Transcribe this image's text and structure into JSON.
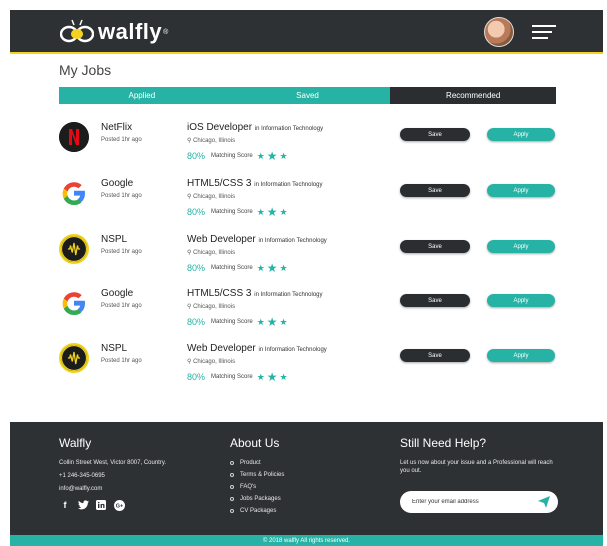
{
  "header": {
    "brand": "walfly",
    "brand_mark": "®",
    "colors": {
      "bar": "#2e3134",
      "accent": "#f4d21f"
    }
  },
  "page_title": "My Jobs",
  "tabs": [
    {
      "label": "Applied",
      "active": false
    },
    {
      "label": "Saved",
      "active": false
    },
    {
      "label": "Recommended",
      "active": true
    }
  ],
  "jobs": [
    {
      "company": "NetFlix",
      "logo": "netflix-logo",
      "posted": "Posted 1hr ago",
      "title": "iOS Developer",
      "category": "in Information Technology",
      "location": "Chicago, Illinois",
      "score": "80%",
      "score_label": "Matching Score",
      "save": "Save",
      "apply": "Apply"
    },
    {
      "company": "Google",
      "logo": "google-logo",
      "posted": "Posted 1hr ago",
      "title": "HTML5/CSS 3",
      "category": "in Information Technology",
      "location": "Chicago, Illinois",
      "score": "80%",
      "score_label": "Matching Score",
      "save": "Save",
      "apply": "Apply"
    },
    {
      "company": "NSPL",
      "logo": "nspl-logo",
      "posted": "Posted 1hr ago",
      "title": "Web Developer",
      "category": "in Information Technology",
      "location": "Chicago, Illinois",
      "score": "80%",
      "score_label": "Matching Score",
      "save": "Save",
      "apply": "Apply"
    },
    {
      "company": "Google",
      "logo": "google-logo",
      "posted": "Posted 1hr ago",
      "title": "HTML5/CSS 3",
      "category": "in Information Technology",
      "location": "Chicago, Illinois",
      "score": "80%",
      "score_label": "Matching Score",
      "save": "Save",
      "apply": "Apply"
    },
    {
      "company": "NSPL",
      "logo": "nspl-logo",
      "posted": "Posted 1hr ago",
      "title": "Web Developer",
      "category": "in Information Technology",
      "location": "Chicago, Illinois",
      "score": "80%",
      "score_label": "Matching Score",
      "save": "Save",
      "apply": "Apply"
    }
  ],
  "footer": {
    "brand": {
      "title": "Walfly",
      "address": "Collin Street West, Victor 8007, Country.",
      "phone": "+1 246-345-0695",
      "email": "info@walfly.com",
      "social": [
        "facebook-icon",
        "twitter-icon",
        "linkedin-icon",
        "google-plus-icon"
      ]
    },
    "about": {
      "title": "About Us",
      "links": [
        "Product",
        "Terms & Policies",
        "FAQ's",
        "Jobs Packages",
        "CV Packages"
      ]
    },
    "help": {
      "title": "Still Need Help?",
      "text": "Let us now about your issue and a Professional will reach you out.",
      "email_placeholder": "Enter your email address"
    },
    "copyright": "© 2018 walfly All rights reserved."
  },
  "colors": {
    "teal": "#26b3a5",
    "dark": "#2b2e31"
  }
}
